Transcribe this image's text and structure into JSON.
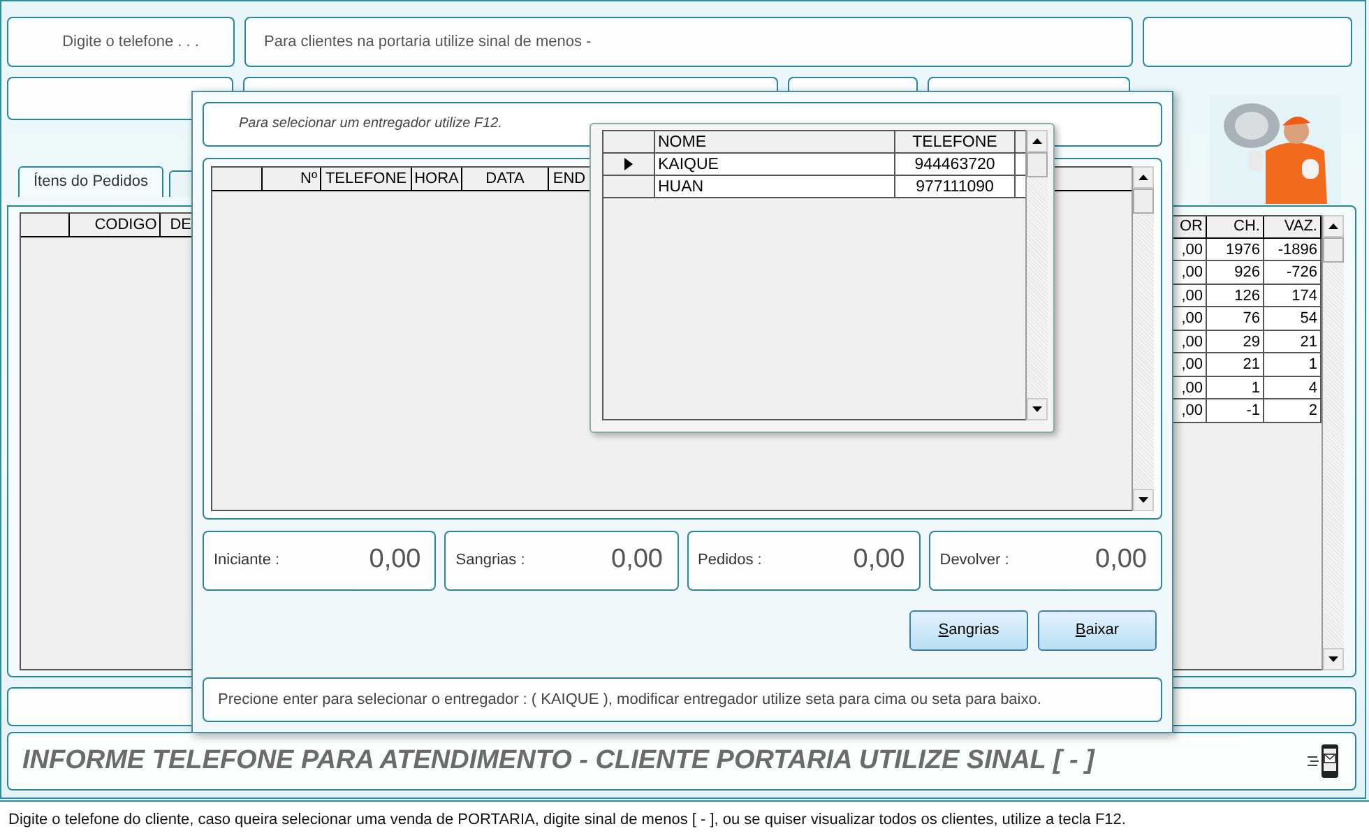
{
  "phone_field": {
    "label": "Digite o telefone . . ."
  },
  "portaria_hint": "Para clientes na portaria utilize sinal de menos  -",
  "tabs": [
    {
      "label": "Ítens do Pedidos",
      "selected": true
    },
    {
      "selected": false
    }
  ],
  "items_table": {
    "columns": [
      "CODIGO",
      "DE"
    ]
  },
  "stock_table": {
    "columns": [
      "OR",
      "CH.",
      "VAZ."
    ],
    "rows": [
      [
        ",00",
        "1976",
        "-1896"
      ],
      [
        ",00",
        "926",
        "-726"
      ],
      [
        ",00",
        "126",
        "174"
      ],
      [
        ",00",
        "76",
        "54"
      ],
      [
        ",00",
        "29",
        "21"
      ],
      [
        ",00",
        "21",
        "1"
      ],
      [
        ",00",
        "1",
        "4"
      ],
      [
        ",00",
        "-1",
        "2"
      ]
    ]
  },
  "dialog": {
    "hint": "Para selecionar um entregador utilize F12.",
    "orders_table": {
      "columns": [
        "Nº",
        "TELEFONE",
        "HORA",
        "DATA",
        "END"
      ]
    },
    "totals": [
      {
        "label": "Iniciante :",
        "value": "0,00"
      },
      {
        "label": "Sangrias :",
        "value": "0,00"
      },
      {
        "label": "Pedidos :",
        "value": "0,00"
      },
      {
        "label": "Devolver :",
        "value": "0,00"
      }
    ],
    "buttons": [
      "Sangrias",
      "Baixar"
    ],
    "message": "Precione enter para selecionar o entregador : ( KAIQUE ), modificar entregador utilize seta para cima ou seta para baixo."
  },
  "courier_popup": {
    "columns": [
      "NOME",
      "TELEFONE"
    ],
    "rows": [
      {
        "name": "KAIQUE",
        "phone": "944463720",
        "selected": true
      },
      {
        "name": "HUAN",
        "phone": "977111090",
        "selected": false
      }
    ]
  },
  "banner": "INFORME TELEFONE PARA ATENDIMENTO - CLIENTE PORTARIA UTILIZE SINAL  [ - ]",
  "status_bar": "Digite o telefone do cliente, caso queira selecionar uma venda de PORTARIA, digite sinal de menos [ - ], ou se quiser visualizar todos os clientes, utilize a tecla F12."
}
